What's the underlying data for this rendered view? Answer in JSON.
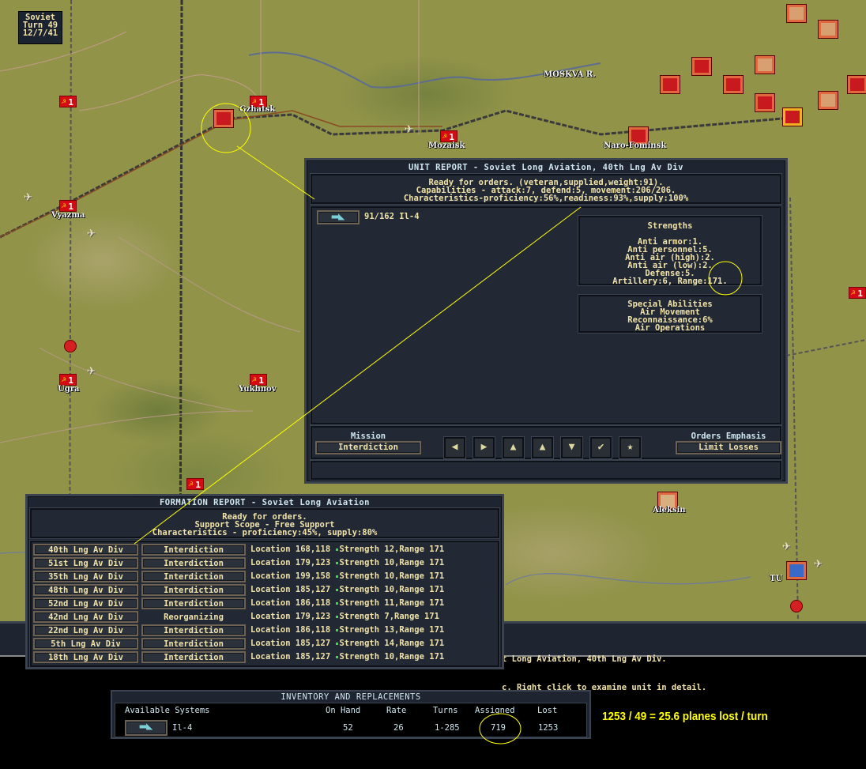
{
  "game": {
    "side": "Soviet",
    "turn": "Turn 49",
    "date": "12/7/41"
  },
  "map": {
    "cities": [
      "Gzhatsk",
      "Mozaisk",
      "Naro-Fominsk",
      "Vyazma",
      "Ugra",
      "Yukhnov",
      "MOSKVA R.",
      "Aleksin",
      "TU"
    ],
    "unit_flag_label": "1"
  },
  "unit_report": {
    "title": "UNIT REPORT - Soviet Long Aviation, 40th Lng Av Div",
    "status": "Ready for orders. (veteran,supplied,weight:91).",
    "capabilities": "Capabilities - attack:7, defend:5, movement:206/206.",
    "characteristics": "Characteristics-proficiency:56%,readiness:93%,supply:100%",
    "equipment": {
      "icon": "bomber-plane-icon",
      "label": "91/162 Il-4"
    },
    "strengths": {
      "title": "Strengths",
      "lines": [
        "Anti armor:1.",
        "Anti personnel:5.",
        "Anti air (high):2.",
        "Anti air (low):2.",
        "Defense:5.",
        "Artillery:6, Range:171."
      ]
    },
    "special": {
      "title": "Special Abilities",
      "lines": [
        "Air Movement",
        "Reconnaissance:6%",
        "Air Operations"
      ]
    },
    "mission": {
      "label": "Mission",
      "value": "Interdiction"
    },
    "orders": {
      "label": "Orders Emphasis",
      "value": "Limit Losses"
    },
    "buttons": [
      {
        "name": "previous-unit",
        "glyph": "◀"
      },
      {
        "name": "next-unit",
        "glyph": "▶"
      },
      {
        "name": "cycle-units",
        "glyph": "▲"
      },
      {
        "name": "move-up",
        "glyph": "▲"
      },
      {
        "name": "move-down",
        "glyph": "▼"
      },
      {
        "name": "confirm",
        "glyph": "✔"
      },
      {
        "name": "favorite",
        "glyph": "★"
      }
    ]
  },
  "formation_report": {
    "title": "FORMATION REPORT - Soviet Long Aviation",
    "status": "Ready for orders.",
    "scope": "Support Scope - Free Support",
    "characteristics": "Characteristics - proficiency:45%, supply:80%",
    "rows": [
      {
        "name": "40th Lng Av Div",
        "mission": "Interdiction",
        "location": "Location 168,118",
        "strength": "Strength 12,Range 171"
      },
      {
        "name": "51st Lng Av Div",
        "mission": "Interdiction",
        "location": "Location 179,123",
        "strength": "Strength 10,Range 171"
      },
      {
        "name": "35th Lng Av Div",
        "mission": "Interdiction",
        "location": "Location 199,158",
        "strength": "Strength 10,Range 171"
      },
      {
        "name": "48th Lng Av Div",
        "mission": "Interdiction",
        "location": "Location 185,127",
        "strength": "Strength 10,Range 171"
      },
      {
        "name": "52nd Lng Av Div",
        "mission": "Interdiction",
        "location": "Location 186,118",
        "strength": "Strength 11,Range 171"
      },
      {
        "name": "42nd Lng Av Div",
        "mission": "Reorganizing",
        "location": "Location 179,123",
        "strength": "Strength 7,Range 171"
      },
      {
        "name": "22nd Lng Av Div",
        "mission": "Interdiction",
        "location": "Location 186,118",
        "strength": "Strength 13,Range 171"
      },
      {
        "name": "5th Lng Av Div",
        "mission": "Interdiction",
        "location": "Location 185,127",
        "strength": "Strength 14,Range 171"
      },
      {
        "name": "18th Lng Av Div",
        "mission": "Interdiction",
        "location": "Location 185,127",
        "strength": "Strength 10,Range 171"
      }
    ]
  },
  "status_bar": {
    "line1": "t Long Aviation, 40th Lng Av Div.",
    "line2": "c. Right click to examine unit in detail."
  },
  "inventory": {
    "title": "INVENTORY AND REPLACEMENTS",
    "headers": [
      "Available Systems",
      "On Hand",
      "Rate",
      "Turns",
      "Assigned",
      "Lost"
    ],
    "rows": [
      {
        "system": "Il-4",
        "on_hand": "52",
        "rate": "26",
        "turns": "1-285",
        "assigned": "719",
        "lost": "1253"
      }
    ]
  },
  "annotation": {
    "text": "1253 / 49 = 25.6 planes lost / turn",
    "color": "#ffff00"
  }
}
